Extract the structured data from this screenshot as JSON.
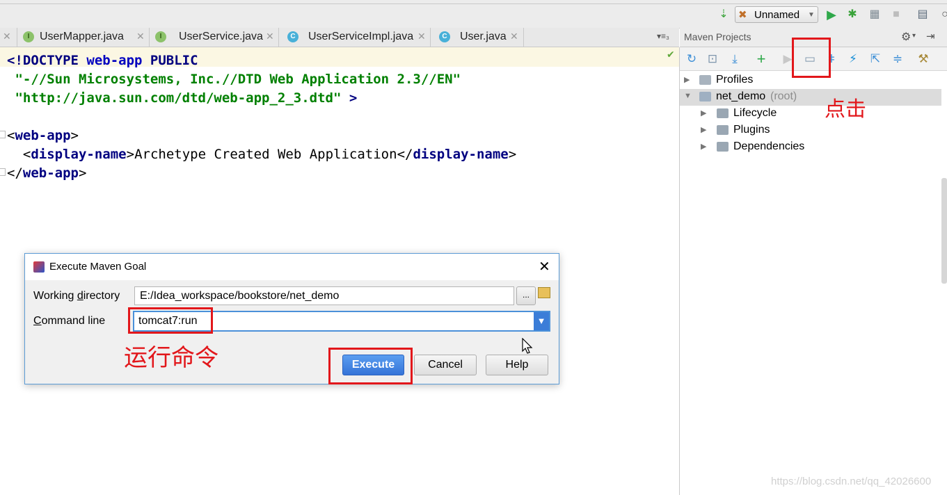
{
  "toolbar": {
    "run_config_label": "Unnamed",
    "icons": [
      "sort-icon",
      "maven-run-config-icon",
      "run-icon",
      "debug-icon",
      "coverage-icon",
      "stop-icon",
      "structure-icon",
      "search-icon"
    ]
  },
  "tabs": [
    {
      "kind": "I",
      "name": "UserMapper.java"
    },
    {
      "kind": "I",
      "name": "UserService.java"
    },
    {
      "kind": "C",
      "name": "UserServiceImpl.java"
    },
    {
      "kind": "C",
      "name": "User.java"
    }
  ],
  "tabs_menu": "▾≡₃",
  "editor": {
    "line1_a": "<!DOCTYPE ",
    "line1_b": "web-app",
    "line1_c": " PUBLIC",
    "line2": " \"-//Sun Microsystems, Inc.//DTD Web Application 2.3//EN\"",
    "line3_a": " \"http://java.sun.com/dtd/web-app_2_3.dtd\"",
    "line3_b": " >",
    "line5_open": "<",
    "line5_tag": "web-app",
    "line5_close": ">",
    "line6_indent": "  <",
    "line6_tag": "display-name",
    "line6_gt": ">",
    "line6_text": "Archetype Created Web Application",
    "line6_end_open": "</",
    "line6_end_tag": "display-name",
    "line6_end_close": ">",
    "line7_open": "</",
    "line7_tag": "web-app",
    "line7_close": ">"
  },
  "maven": {
    "header": "Maven Projects",
    "tree": [
      {
        "label": "Profiles",
        "suffix": ""
      },
      {
        "label": "net_demo",
        "suffix": "(root)"
      },
      {
        "label": "Lifecycle",
        "suffix": ""
      },
      {
        "label": "Plugins",
        "suffix": ""
      },
      {
        "label": "Dependencies",
        "suffix": ""
      }
    ],
    "annotation": "点击"
  },
  "dialog": {
    "title": "Execute Maven Goal",
    "close": "✕",
    "working_directory_label_pre": "Working ",
    "working_directory_label_u": "d",
    "working_directory_label_post": "irectory",
    "working_directory_value": "E:/Idea_workspace/bookstore/net_demo",
    "browse_label": "...",
    "command_line_label_u": "C",
    "command_line_label_post": "ommand line",
    "command_line_value": "tomcat7:run",
    "annotation": "运行命令",
    "buttons": {
      "execute": "Execute",
      "cancel": "Cancel",
      "help": "Help"
    }
  },
  "watermark": "https://blog.csdn.net/qq_42026600",
  "colors": {
    "highlight_red": "#e2171b",
    "primary_blue": "#3574d8",
    "code_keyword": "#000080",
    "code_string": "#008000"
  }
}
